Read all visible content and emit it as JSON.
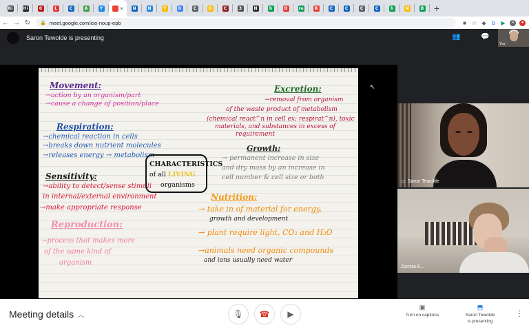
{
  "browser": {
    "tabs": [
      {
        "label": "Ri",
        "color": "#444444"
      },
      {
        "label": "Hi",
        "color": "#222222"
      },
      {
        "label": "0",
        "color": "#b71c1c"
      },
      {
        "label": "L",
        "color": "#e53935"
      },
      {
        "label": "C",
        "color": "#1565c0"
      },
      {
        "label": "A",
        "color": "#43a047"
      },
      {
        "label": "Y",
        "color": "#1e88e5"
      },
      {
        "label": "",
        "color": "#ea4335",
        "active": true
      },
      {
        "label": "N",
        "color": "#1565c0"
      },
      {
        "label": "N",
        "color": "#1e88e5"
      },
      {
        "label": "Y",
        "color": "#fbbc04"
      },
      {
        "label": "h",
        "color": "#4285f4"
      },
      {
        "label": "C",
        "color": "#5f6368"
      },
      {
        "label": "O",
        "color": "#fbbc04"
      },
      {
        "label": "C",
        "color": "#8e2424"
      },
      {
        "label": "3",
        "color": "#555555"
      },
      {
        "label": "N",
        "color": "#333333"
      },
      {
        "label": "h",
        "color": "#0f9d58"
      },
      {
        "label": "D",
        "color": "#e53935"
      },
      {
        "label": "re",
        "color": "#0f9d58"
      },
      {
        "label": "R",
        "color": "#ea4335"
      },
      {
        "label": "C",
        "color": "#1565c0"
      },
      {
        "label": "C",
        "color": "#1565c0"
      },
      {
        "label": "C",
        "color": "#5f6368"
      },
      {
        "label": "C",
        "color": "#1565c0"
      },
      {
        "label": "h",
        "color": "#0f9d58"
      },
      {
        "label": "N",
        "color": "#fbbc04"
      },
      {
        "label": "B",
        "color": "#0f9d58"
      }
    ],
    "active_close": "×",
    "new_tab": "+",
    "url": "meet.google.com/ioo-noup-epb",
    "avatar_letter": "A"
  },
  "meet": {
    "presenting_text": "Saron Tewolde is presenting",
    "self_label": "You"
  },
  "notebook": {
    "movement_heading": "Movement:",
    "movement_1": "→action by an organism/part",
    "movement_2": "→cause a change of position/place",
    "respiration_heading": "Respiration:",
    "respiration_1": "→chemical reaction in cells",
    "respiration_2": "→breaks down nutrient molecules",
    "respiration_3": "→releases energy → metabolism",
    "sensitivity_heading": "Sensitivity:",
    "sensitivity_1": "→ability to detect/sense stimuli",
    "sensitivity_2": "in internal/external environment",
    "sensitivity_3": "→make appropriate response",
    "reproduction_heading": "Reproduction:",
    "reproduction_1": "→process that makes more",
    "reproduction_2": "of the same kind of",
    "reproduction_3": "organism",
    "box_line1": "CHARACTERISTICS",
    "box_line2_a": "of all ",
    "box_line2_b": "LIVING",
    "box_line3": "organisms",
    "excretion_heading": "Excretion:",
    "excretion_1": "→removal from organism",
    "excretion_2": "of the waste product of metabolism",
    "excretion_3": "(chemical react^n in cell ex: respirat^n), toxic",
    "excretion_4": "materials, and substances in excess of",
    "excretion_5": "requirement",
    "growth_heading": "Growth:",
    "growth_1": "→ permanent increase in size",
    "growth_2": "and dry mass by an increase in",
    "growth_3": "cell number & cell size or both",
    "nutrition_heading": "Nutrition:",
    "nutrition_1": "→ take in of material for energy,",
    "nutrition_2": "growth and development",
    "nutrition_3": "→ plant require light, CO₂ and H₂O",
    "nutrition_4": "→animals need organic compounds",
    "nutrition_5": "and ions usually need water"
  },
  "participants": [
    {
      "name": "Saron Tewolde"
    },
    {
      "name": "Zamira E..."
    }
  ],
  "bottom_bar": {
    "meeting_details": "Meeting details",
    "captions_label": "Turn on captions",
    "presenting_line1": "Saron Tewolde",
    "presenting_line2": "is presenting"
  }
}
